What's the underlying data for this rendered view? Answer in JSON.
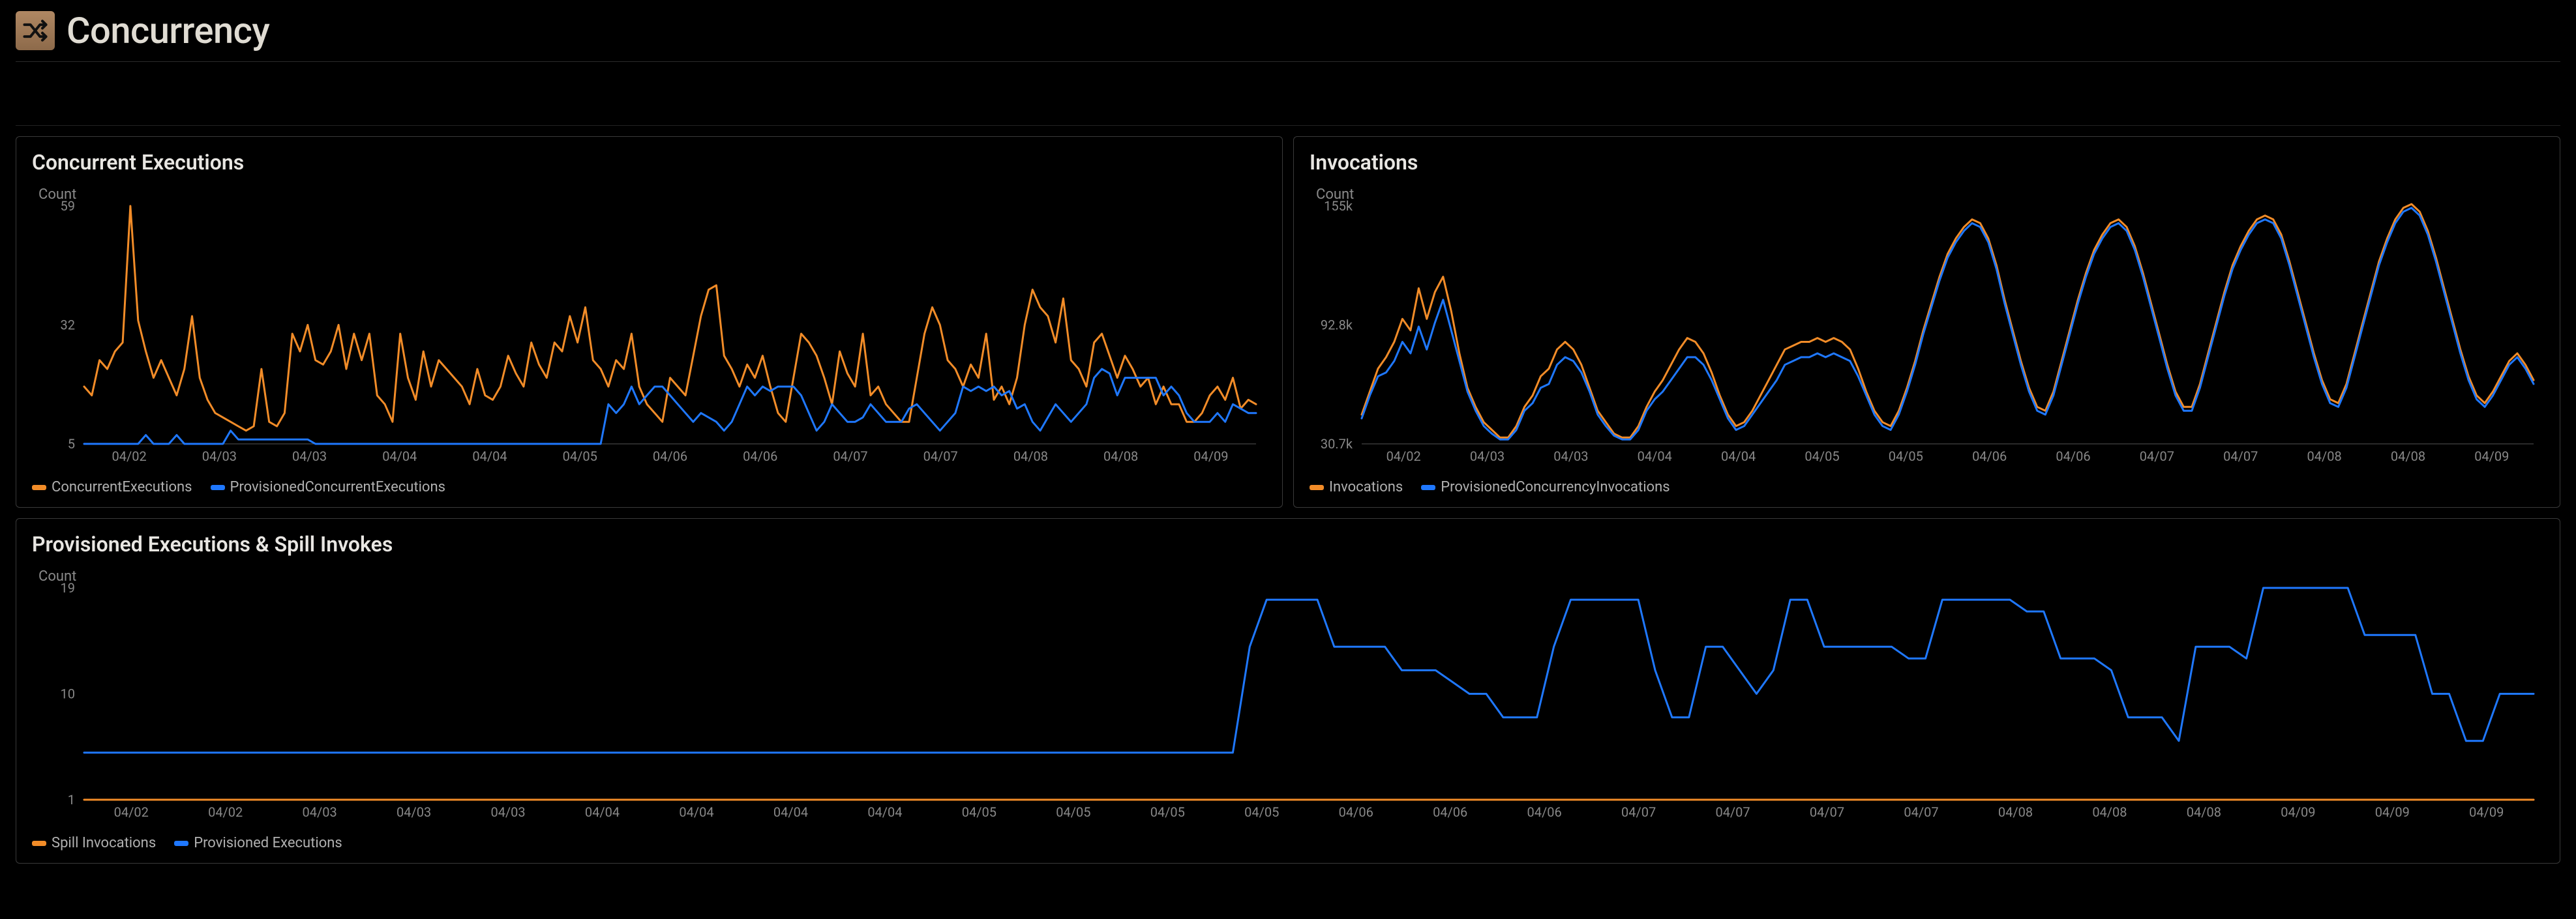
{
  "colors": {
    "orange": "#f28c28",
    "blue": "#1f78ff"
  },
  "header": {
    "title": "Concurrency"
  },
  "panels": {
    "p1": {
      "title": "Concurrent Executions",
      "ylabel": "Count"
    },
    "p2": {
      "title": "Invocations",
      "ylabel": "Count"
    },
    "p3": {
      "title": "Provisioned Executions & Spill Invokes",
      "ylabel": "Count"
    }
  },
  "legends": {
    "p1": [
      {
        "name": "ConcurrentExecutions",
        "color": "orange"
      },
      {
        "name": "ProvisionedConcurrentExecutions",
        "color": "blue"
      }
    ],
    "p2": [
      {
        "name": "Invocations",
        "color": "orange"
      },
      {
        "name": "ProvisionedConcurrencyInvocations",
        "color": "blue"
      }
    ],
    "p3": [
      {
        "name": "Spill Invocations",
        "color": "orange"
      },
      {
        "name": "Provisioned Executions",
        "color": "blue"
      }
    ]
  },
  "chart_data": [
    {
      "id": "p1",
      "type": "line",
      "title": "Concurrent Executions",
      "ylabel": "Count",
      "x_tick_labels": [
        "04/02",
        "04/03",
        "04/03",
        "04/04",
        "04/04",
        "04/05",
        "04/06",
        "04/06",
        "04/07",
        "04/07",
        "04/08",
        "04/08",
        "04/09"
      ],
      "y_ticks": [
        5,
        32,
        59
      ],
      "ylim": [
        5,
        59
      ],
      "series": [
        {
          "name": "ConcurrentExecutions",
          "color": "orange",
          "values": [
            18,
            16,
            24,
            22,
            26,
            28,
            59,
            33,
            26,
            20,
            24,
            20,
            16,
            22,
            34,
            20,
            15,
            12,
            11,
            10,
            9,
            8,
            9,
            22,
            10,
            9,
            12,
            30,
            26,
            32,
            24,
            23,
            26,
            32,
            22,
            30,
            24,
            30,
            16,
            14,
            10,
            30,
            20,
            15,
            26,
            18,
            24,
            22,
            20,
            18,
            14,
            22,
            16,
            15,
            18,
            25,
            21,
            18,
            28,
            23,
            20,
            28,
            26,
            34,
            28,
            36,
            24,
            22,
            18,
            24,
            22,
            30,
            18,
            14,
            12,
            10,
            20,
            18,
            16,
            25,
            34,
            40,
            41,
            25,
            22,
            18,
            23,
            20,
            25,
            18,
            12,
            10,
            20,
            30,
            28,
            25,
            20,
            14,
            26,
            21,
            18,
            30,
            16,
            18,
            14,
            12,
            10,
            10,
            20,
            30,
            36,
            32,
            24,
            22,
            18,
            23,
            20,
            30,
            15,
            18,
            14,
            20,
            32,
            40,
            36,
            34,
            28,
            38,
            24,
            22,
            18,
            28,
            30,
            25,
            20,
            25,
            22,
            18,
            20,
            14,
            18,
            14,
            14,
            10,
            10,
            12,
            16,
            18,
            15,
            20,
            13,
            15,
            14
          ]
        },
        {
          "name": "ProvisionedConcurrentExecutions",
          "color": "blue",
          "values": [
            5,
            5,
            5,
            5,
            5,
            5,
            5,
            5,
            7,
            5,
            5,
            5,
            7,
            5,
            5,
            5,
            5,
            5,
            5,
            8,
            6,
            6,
            6,
            6,
            6,
            6,
            6,
            6,
            6,
            6,
            5,
            5,
            5,
            5,
            5,
            5,
            5,
            5,
            5,
            5,
            5,
            5,
            5,
            5,
            5,
            5,
            5,
            5,
            5,
            5,
            5,
            5,
            5,
            5,
            5,
            5,
            5,
            5,
            5,
            5,
            5,
            5,
            5,
            5,
            5,
            5,
            5,
            5,
            14,
            12,
            14,
            18,
            14,
            16,
            18,
            18,
            16,
            14,
            12,
            10,
            12,
            11,
            10,
            8,
            10,
            14,
            18,
            16,
            18,
            17,
            18,
            18,
            18,
            16,
            12,
            8,
            10,
            14,
            12,
            10,
            10,
            11,
            14,
            12,
            10,
            10,
            10,
            13,
            14,
            12,
            10,
            8,
            10,
            12,
            18,
            17,
            18,
            17,
            18,
            16,
            17,
            13,
            14,
            10,
            8,
            11,
            14,
            12,
            10,
            12,
            14,
            20,
            22,
            21,
            16,
            20,
            20,
            20,
            20,
            20,
            16,
            18,
            16,
            12,
            10,
            10,
            10,
            12,
            10,
            14,
            13,
            12,
            12
          ]
        }
      ]
    },
    {
      "id": "p2",
      "type": "line",
      "title": "Invocations",
      "ylabel": "Count",
      "x_tick_labels": [
        "04/02",
        "04/03",
        "04/03",
        "04/04",
        "04/04",
        "04/05",
        "04/05",
        "04/06",
        "04/06",
        "04/07",
        "04/07",
        "04/08",
        "04/08",
        "04/09"
      ],
      "y_ticks": [
        30700,
        92800,
        155000
      ],
      "y_tick_labels": [
        "30.7k",
        "92.8k",
        "155k"
      ],
      "ylim": [
        30700,
        155000
      ],
      "series": [
        {
          "name": "Invocations",
          "color": "orange",
          "values": [
            46000,
            58000,
            70000,
            76000,
            84000,
            96000,
            90000,
            112000,
            96000,
            110000,
            118000,
            100000,
            78000,
            60000,
            50000,
            42000,
            38000,
            34000,
            34000,
            40000,
            50000,
            56000,
            66000,
            70000,
            80000,
            84000,
            80000,
            72000,
            60000,
            48000,
            42000,
            36000,
            34000,
            34000,
            40000,
            50000,
            58000,
            64000,
            72000,
            80000,
            86000,
            84000,
            78000,
            68000,
            56000,
            46000,
            40000,
            42000,
            48000,
            56000,
            64000,
            72000,
            80000,
            82000,
            84000,
            84000,
            86000,
            84000,
            86000,
            84000,
            80000,
            70000,
            58000,
            48000,
            42000,
            40000,
            48000,
            60000,
            74000,
            90000,
            104000,
            118000,
            130000,
            138000,
            144000,
            148000,
            146000,
            138000,
            124000,
            106000,
            90000,
            74000,
            60000,
            50000,
            48000,
            58000,
            74000,
            90000,
            106000,
            120000,
            132000,
            140000,
            146000,
            148000,
            144000,
            134000,
            120000,
            104000,
            88000,
            72000,
            58000,
            50000,
            50000,
            62000,
            78000,
            94000,
            110000,
            124000,
            134000,
            142000,
            148000,
            150000,
            148000,
            140000,
            126000,
            110000,
            94000,
            78000,
            64000,
            54000,
            52000,
            62000,
            78000,
            94000,
            110000,
            126000,
            138000,
            148000,
            154000,
            156000,
            152000,
            142000,
            128000,
            112000,
            96000,
            80000,
            66000,
            56000,
            52000,
            58000,
            66000,
            74000,
            78000,
            72000,
            64000
          ]
        },
        {
          "name": "ProvisionedConcurrencyInvocations",
          "color": "blue",
          "values": [
            44000,
            56000,
            66000,
            68000,
            74000,
            84000,
            78000,
            92000,
            80000,
            94000,
            106000,
            90000,
            74000,
            58000,
            48000,
            40000,
            36000,
            33000,
            33000,
            38000,
            48000,
            52000,
            60000,
            62000,
            72000,
            76000,
            74000,
            68000,
            58000,
            46000,
            40000,
            35000,
            33000,
            33000,
            38000,
            48000,
            54000,
            58000,
            64000,
            70000,
            76000,
            76000,
            72000,
            64000,
            54000,
            44000,
            38000,
            40000,
            46000,
            52000,
            58000,
            64000,
            72000,
            74000,
            76000,
            76000,
            78000,
            76000,
            78000,
            76000,
            74000,
            66000,
            56000,
            46000,
            40000,
            38000,
            46000,
            58000,
            72000,
            88000,
            102000,
            116000,
            128000,
            136000,
            142000,
            146000,
            144000,
            136000,
            122000,
            104000,
            88000,
            72000,
            58000,
            48000,
            46000,
            56000,
            72000,
            88000,
            104000,
            118000,
            130000,
            138000,
            144000,
            146000,
            142000,
            132000,
            118000,
            102000,
            86000,
            70000,
            56000,
            48000,
            48000,
            60000,
            76000,
            92000,
            108000,
            122000,
            132000,
            140000,
            146000,
            148000,
            146000,
            138000,
            124000,
            108000,
            92000,
            76000,
            62000,
            52000,
            50000,
            60000,
            76000,
            92000,
            108000,
            124000,
            136000,
            146000,
            152000,
            154000,
            150000,
            140000,
            126000,
            110000,
            94000,
            78000,
            64000,
            54000,
            50000,
            56000,
            64000,
            72000,
            76000,
            70000,
            62000
          ]
        }
      ]
    },
    {
      "id": "p3",
      "type": "line",
      "title": "Provisioned Executions & Spill Invokes",
      "ylabel": "Count",
      "x_tick_labels": [
        "04/02",
        "04/02",
        "04/03",
        "04/03",
        "04/03",
        "04/04",
        "04/04",
        "04/04",
        "04/04",
        "04/05",
        "04/05",
        "04/05",
        "04/05",
        "04/06",
        "04/06",
        "04/06",
        "04/07",
        "04/07",
        "04/07",
        "04/07",
        "04/08",
        "04/08",
        "04/08",
        "04/09",
        "04/09",
        "04/09"
      ],
      "y_ticks": [
        1,
        10,
        19
      ],
      "ylim": [
        1,
        19
      ],
      "yscale_hint": "log-like",
      "series": [
        {
          "name": "Spill Invocations",
          "color": "orange",
          "values": [
            1,
            1,
            1,
            1,
            1,
            1,
            1,
            1,
            1,
            1,
            1,
            1,
            1,
            1,
            1,
            1,
            1,
            1,
            1,
            1,
            1,
            1,
            1,
            1,
            1,
            1,
            1,
            1,
            1,
            1,
            1,
            1,
            1,
            1,
            1,
            1,
            1,
            1,
            1,
            1,
            1,
            1,
            1,
            1,
            1,
            1,
            1,
            1,
            1,
            1,
            1,
            1,
            1,
            1,
            1,
            1,
            1,
            1,
            1,
            1,
            1,
            1,
            1,
            1,
            1,
            1,
            1,
            1,
            1,
            1,
            1,
            1,
            1,
            1,
            1,
            1,
            1,
            1,
            1,
            1,
            1,
            1,
            1,
            1,
            1,
            1,
            1,
            1,
            1,
            1,
            1,
            1,
            1,
            1,
            1,
            1,
            1,
            1,
            1,
            1,
            1,
            1,
            1,
            1,
            1,
            1,
            1,
            1,
            1,
            1,
            1,
            1,
            1,
            1,
            1,
            1,
            1,
            1,
            1,
            1,
            1,
            1,
            1,
            1,
            1,
            1,
            1,
            1,
            1,
            1,
            1,
            1,
            1,
            1,
            1,
            1,
            1,
            1,
            1,
            1,
            1,
            1,
            1,
            1,
            1,
            1
          ]
        },
        {
          "name": "Provisioned Executions",
          "color": "blue",
          "values": [
            5,
            5,
            5,
            5,
            5,
            5,
            5,
            5,
            5,
            5,
            5,
            5,
            5,
            5,
            5,
            5,
            5,
            5,
            5,
            5,
            5,
            5,
            5,
            5,
            5,
            5,
            5,
            5,
            5,
            5,
            5,
            5,
            5,
            5,
            5,
            5,
            5,
            5,
            5,
            5,
            5,
            5,
            5,
            5,
            5,
            5,
            5,
            5,
            5,
            5,
            5,
            5,
            5,
            5,
            5,
            5,
            5,
            5,
            5,
            5,
            5,
            5,
            5,
            5,
            5,
            5,
            5,
            5,
            5,
            14,
            18,
            18,
            18,
            18,
            14,
            14,
            14,
            14,
            12,
            12,
            12,
            11,
            10,
            10,
            8,
            8,
            8,
            14,
            18,
            18,
            18,
            18,
            18,
            12,
            8,
            8,
            14,
            14,
            12,
            10,
            12,
            18,
            18,
            14,
            14,
            14,
            14,
            14,
            13,
            13,
            18,
            18,
            18,
            18,
            18,
            17,
            17,
            13,
            13,
            13,
            12,
            8,
            8,
            8,
            6,
            14,
            14,
            14,
            13,
            19,
            19,
            19,
            19,
            19,
            19,
            15,
            15,
            15,
            15,
            10,
            10,
            6,
            6,
            10,
            10,
            10
          ]
        }
      ]
    }
  ]
}
